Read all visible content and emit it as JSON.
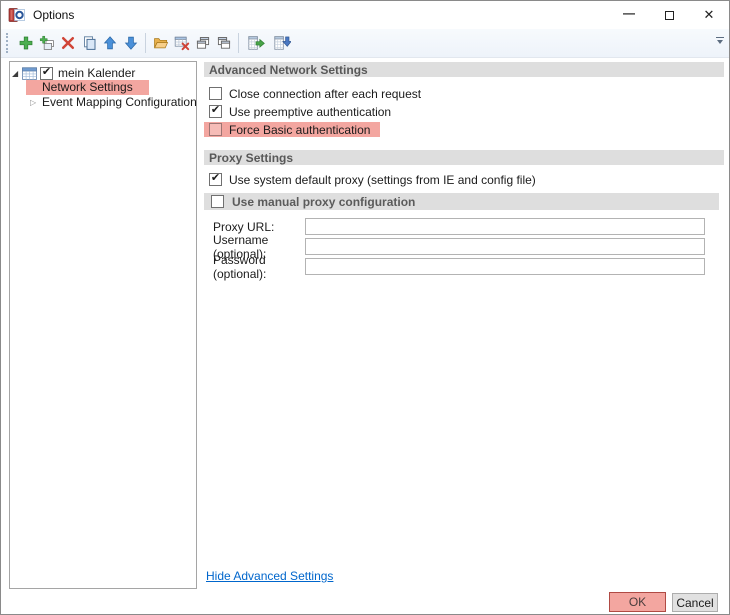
{
  "window": {
    "title": "Options",
    "minimize_glyph": "—",
    "close_glyph": "✕"
  },
  "toolbar": {
    "buttons": [
      {
        "icon": "plus-icon",
        "name": "add-profile"
      },
      {
        "icon": "add-multiple-icon",
        "name": "add-multiple-profiles"
      },
      {
        "icon": "red-x-icon",
        "name": "delete-profile"
      },
      {
        "icon": "copy-pages-icon",
        "name": "copy-profile"
      },
      {
        "icon": "arrow-up-icon",
        "name": "move-up"
      },
      {
        "icon": "arrow-down-icon",
        "name": "move-down"
      },
      {
        "icon": "folder-icon",
        "name": "open-folder"
      },
      {
        "icon": "table-delete-icon",
        "name": "clear-cache"
      },
      {
        "icon": "cascade-windows-icon",
        "name": "collapse-all"
      },
      {
        "icon": "cascade-windows-icon",
        "name": "expand-all"
      },
      {
        "icon": "export-table-icon",
        "name": "export-profiles"
      },
      {
        "icon": "import-table-icon",
        "name": "import-profiles"
      }
    ]
  },
  "tree": {
    "items": [
      {
        "label": "mein Kalender",
        "expander": "◢",
        "check": "✔",
        "icon": "calendar-icon"
      },
      {
        "label": "Network Settings",
        "highlighted": true
      },
      {
        "label": "Event Mapping Configuration",
        "expander": "▷"
      }
    ]
  },
  "panel": {
    "advanced_network": {
      "header": "Advanced Network Settings",
      "options": [
        {
          "label": "Close connection after each request",
          "check": ""
        },
        {
          "label": "Use preemptive authentication",
          "check": "✔"
        },
        {
          "label": "Force Basic authentication",
          "check": "",
          "highlighted": true
        }
      ]
    },
    "proxy": {
      "header": "Proxy Settings",
      "system_default": {
        "label": "Use system default proxy (settings from IE and config file)",
        "check": "✔"
      },
      "manual": {
        "label": "Use manual proxy configuration",
        "check": ""
      },
      "fields": [
        {
          "label": "Proxy URL:",
          "value": ""
        },
        {
          "label": "Username (optional):",
          "value": ""
        },
        {
          "label": "Password (optional):",
          "value": ""
        }
      ]
    },
    "link_label": "Hide Advanced Settings"
  },
  "footer": {
    "ok_label": "OK",
    "cancel_label": "Cancel"
  },
  "colors": {
    "highlight": "#f3a6a0",
    "header_bar": "#dedede",
    "link": "#0066cc",
    "ok_border": "#b04a44"
  }
}
